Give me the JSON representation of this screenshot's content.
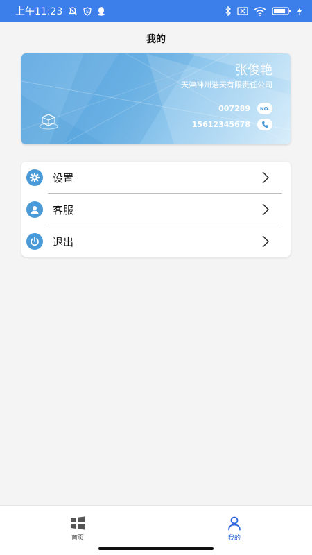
{
  "status_bar": {
    "time": "上午11:23",
    "battery_level": 0.85
  },
  "page": {
    "title": "我的"
  },
  "profile": {
    "name": "张俊艳",
    "company": "天津神州浩天有限责任公司",
    "id_number": "007289",
    "id_badge": "NO.",
    "phone": "15612345678"
  },
  "menu": [
    {
      "label": "设置",
      "icon": "gear-icon"
    },
    {
      "label": "客服",
      "icon": "customer-service-icon"
    },
    {
      "label": "退出",
      "icon": "power-icon"
    }
  ],
  "bottom_nav": {
    "items": [
      {
        "label": "首页",
        "icon": "windows-grid-icon",
        "active": false
      },
      {
        "label": "我的",
        "icon": "person-icon",
        "active": true
      }
    ]
  },
  "colors": {
    "status_bar": "#3d7fea",
    "accent": "#2b63d8",
    "icon_blue": "#4a9ad8",
    "background": "#f4f4f4"
  }
}
